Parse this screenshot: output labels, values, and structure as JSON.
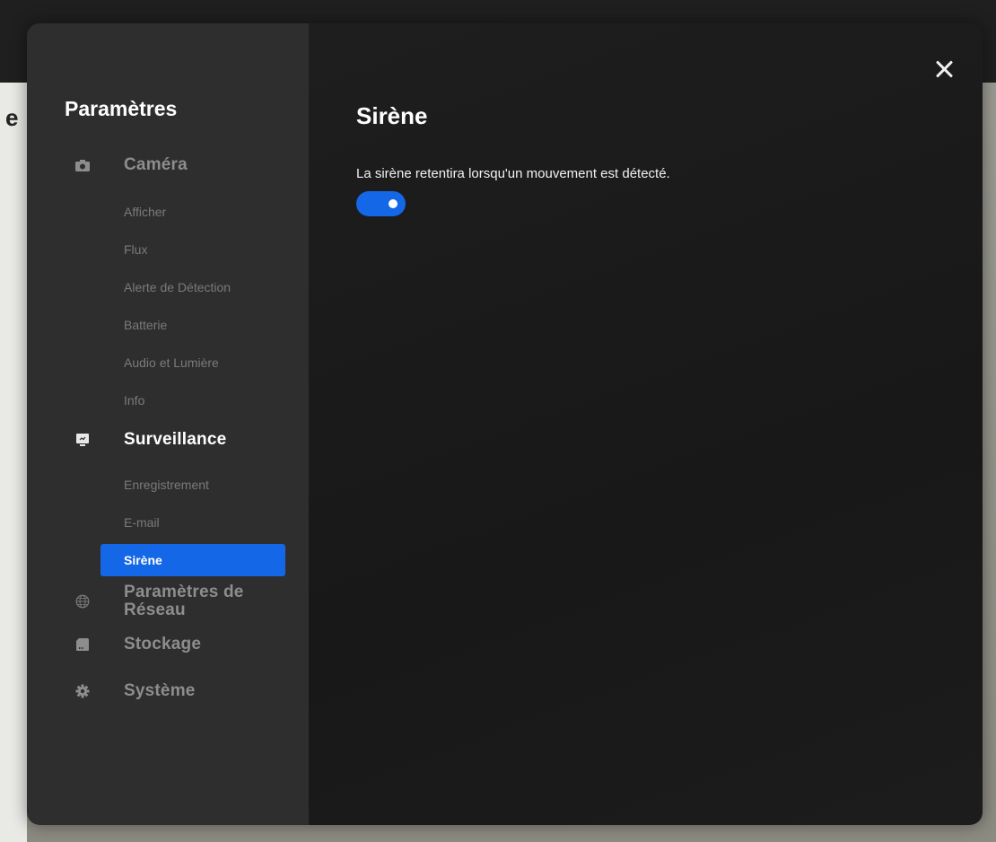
{
  "background": {
    "partial_char": "e"
  },
  "sidebar": {
    "title": "Paramètres",
    "sections": [
      {
        "label": "Caméra",
        "icon": "camera-icon",
        "items": [
          "Afficher",
          "Flux",
          "Alerte de Détection",
          "Batterie",
          "Audio et Lumière",
          "Info"
        ]
      },
      {
        "label": "Surveillance",
        "icon": "monitor-icon",
        "items": [
          "Enregistrement",
          "E-mail",
          "Sirène"
        ]
      },
      {
        "label": "Paramètres de Réseau",
        "icon": "globe-icon",
        "items": []
      },
      {
        "label": "Stockage",
        "icon": "sd-card-icon",
        "items": []
      },
      {
        "label": "Système",
        "icon": "gear-icon",
        "items": []
      }
    ],
    "active_section": "Surveillance",
    "active_item": "Sirène"
  },
  "content": {
    "title": "Sirène",
    "description": "La sirène retentira lorsqu'un mouvement est détecté.",
    "toggle_on": true
  },
  "colors": {
    "accent": "#1467e6",
    "sidebar_bg": "#2e2e2e",
    "content_bg": "#1c1c1c"
  }
}
